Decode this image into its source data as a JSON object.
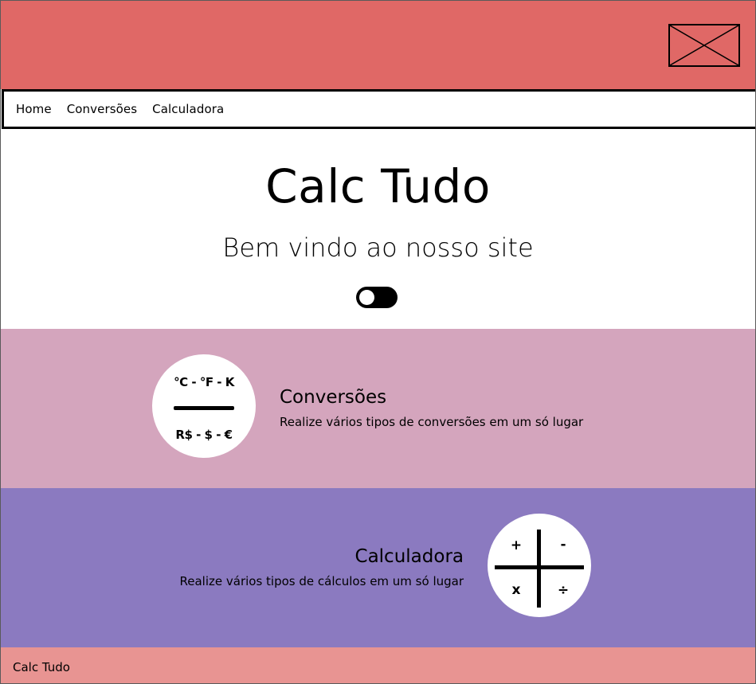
{
  "header": {
    "logo_icon": "image-placeholder-icon",
    "background_color": "#e06866"
  },
  "nav": {
    "items": [
      {
        "label": "Home"
      },
      {
        "label": "Conversões"
      },
      {
        "label": "Calculadora"
      }
    ]
  },
  "hero": {
    "title": "Calc Tudo",
    "subtitle": "Bem vindo ao nosso site",
    "theme_toggle": {
      "on": false,
      "icon": "toggle-switch-icon"
    }
  },
  "sections": {
    "conversions": {
      "background_color": "#d4a5bd",
      "icon_line1": "°C - °F - K",
      "icon_line2": "R$ - $ - €",
      "title": "Conversões",
      "description": "Realize vários tipos de conversões em um só lugar"
    },
    "calculator": {
      "background_color": "#8b7ac0",
      "op_plus": "+",
      "op_minus": "-",
      "op_times": "x",
      "op_divide": "÷",
      "title": "Calculadora",
      "description": "Realize vários tipos de cálculos em um só lugar"
    }
  },
  "footer": {
    "text": "Calc Tudo",
    "background_color": "#e89492"
  }
}
